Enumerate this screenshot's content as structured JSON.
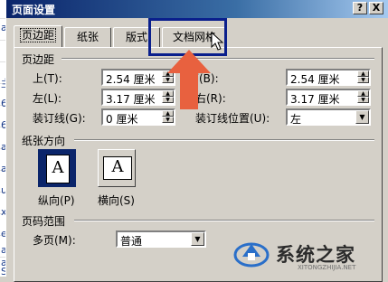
{
  "background_doc": {
    "chars": [
      "a",
      "主",
      "6",
      "6",
      "a",
      "a",
      "u",
      "x",
      "e",
      "a",
      "a",
      "S"
    ]
  },
  "dialog": {
    "title": "页面设置",
    "title_buttons": {
      "help": "?",
      "close": "X"
    },
    "tabs": [
      {
        "label": "页边距",
        "active": true
      },
      {
        "label": "纸张",
        "active": false
      },
      {
        "label": "版式",
        "active": false
      },
      {
        "label": "文档网格",
        "active": false
      }
    ]
  },
  "margins": {
    "group_title": "页边距",
    "top_label": "上(T):",
    "top_value": "2.54 厘米",
    "bottom_label": "下(B):",
    "bottom_value": "2.54 厘米",
    "left_label": "左(L):",
    "left_value": "3.17 厘米",
    "right_label": "右(R):",
    "right_value": "3.17 厘米",
    "gutter_label": "装订线(G):",
    "gutter_value": "0 厘米",
    "gutter_pos_label": "装订线位置(U):",
    "gutter_pos_value": "左"
  },
  "orientation": {
    "group_title": "纸张方向",
    "portrait_glyph": "A",
    "portrait_label": "纵向(P)",
    "landscape_glyph": "A",
    "landscape_label": "横向(S)"
  },
  "pages": {
    "group_title": "页码范围",
    "multiple_label": "多页(M):",
    "multiple_value": "普通"
  },
  "watermark": {
    "brand": "系统之家",
    "site": "XITONGZHIJIA.NET"
  },
  "colors": {
    "highlight_box": "#0a1f8c",
    "arrow": "#e8613f",
    "title_bar": "#0a246a"
  }
}
